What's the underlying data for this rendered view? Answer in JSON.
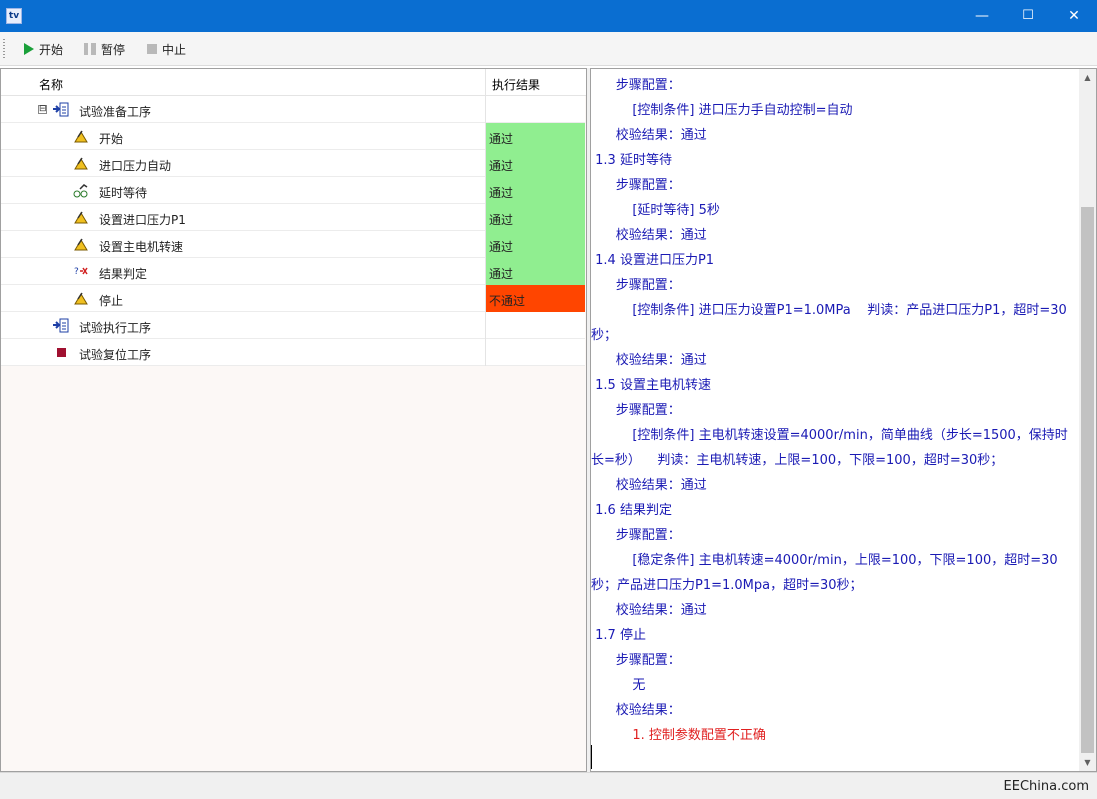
{
  "window": {
    "app_icon_text": "tv",
    "minimize": "—",
    "maximize": "☐",
    "close": "✕"
  },
  "toolbar": {
    "start_label": "开始",
    "pause_label": "暂停",
    "abort_label": "中止"
  },
  "grid": {
    "col_name": "名称",
    "col_result": "执行结果",
    "rows": [
      {
        "label": "试验准备工序",
        "result": "",
        "icon": "procedure-icon",
        "expander": "⊟"
      },
      {
        "label": "开始",
        "result": "通过",
        "icon": "step-icon"
      },
      {
        "label": "进口压力自动",
        "result": "通过",
        "icon": "step-icon"
      },
      {
        "label": "延时等待",
        "result": "通过",
        "icon": "delay-icon"
      },
      {
        "label": "设置进口压力P1",
        "result": "通过",
        "icon": "step-icon"
      },
      {
        "label": "设置主电机转速",
        "result": "通过",
        "icon": "step-icon"
      },
      {
        "label": "结果判定",
        "result": "通过",
        "icon": "judge-icon"
      },
      {
        "label": "停止",
        "result": "不通过",
        "icon": "step-icon"
      },
      {
        "label": "试验执行工序",
        "result": "",
        "icon": "procedure-icon"
      },
      {
        "label": "试验复位工序",
        "result": "",
        "icon": "reset-icon"
      }
    ]
  },
  "colors": {
    "pass": "#90ee90",
    "fail": "#ff4500",
    "log_text": "#1a1ab4",
    "log_error": "#e02020",
    "titlebar": "#0a6ed1"
  },
  "log": [
    "      步骤配置：",
    "          [控制条件] 进口压力手自动控制=自动",
    "      校验结果：通过",
    " 1.3 延时等待",
    "      步骤配置：",
    "          [延时等待] 5秒",
    "      校验结果：通过",
    " 1.4 设置进口压力P1",
    "      步骤配置：",
    "          [控制条件] 进口压力设置P1=1.0MPa    判读：产品进口压力P1，超时=30",
    "秒；",
    "      校验结果：通过",
    " 1.5 设置主电机转速",
    "      步骤配置：",
    "          [控制条件] 主电机转速设置=4000r/min，简单曲线（步长=1500，保持时",
    "长=秒）    判读：主电机转速，上限=100，下限=100，超时=30秒；",
    "      校验结果：通过",
    " 1.6 结果判定",
    "      步骤配置：",
    "          [稳定条件] 主电机转速=4000r/min，上限=100，下限=100，超时=30",
    "秒；产品进口压力P1=1.0Mpa，超时=30秒；",
    "      校验结果：通过",
    " 1.7 停止",
    "      步骤配置：",
    "          无",
    "      校验结果："
  ],
  "log_error": "          1. 控制参数配置不正确",
  "status": {
    "watermark": "EEChina.com"
  }
}
